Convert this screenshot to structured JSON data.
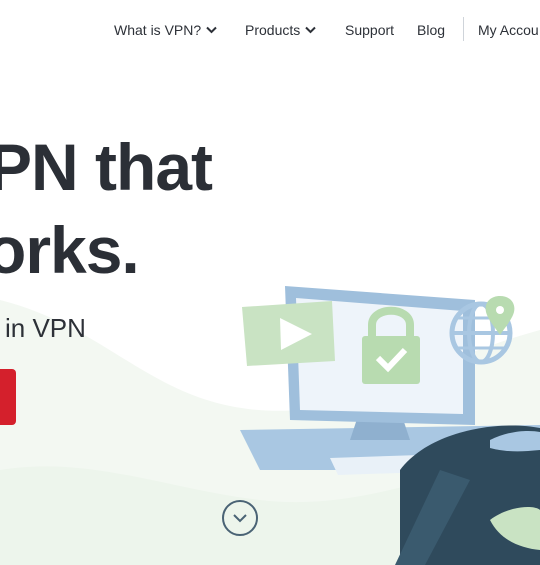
{
  "nav": {
    "items": [
      {
        "label": "What is VPN?",
        "dropdown": true
      },
      {
        "label": "Products",
        "dropdown": true
      },
      {
        "label": "Support",
        "dropdown": false
      },
      {
        "label": "Blog",
        "dropdown": false
      }
    ],
    "account_label": "My Accou"
  },
  "hero": {
    "line1": "PN that",
    "line2": "orks.",
    "subtitle": "in VPN"
  },
  "colors": {
    "accent": "#d4202c",
    "text": "#2d3138",
    "wave": "#eef5ee",
    "screen_green": "#c9e3c3",
    "monitor": "#9fbfdc",
    "navy": "#2f4a5c"
  },
  "icons": {
    "scroll": "chevron-down-circle-icon",
    "nav_dropdown": "chevron-down-icon"
  }
}
